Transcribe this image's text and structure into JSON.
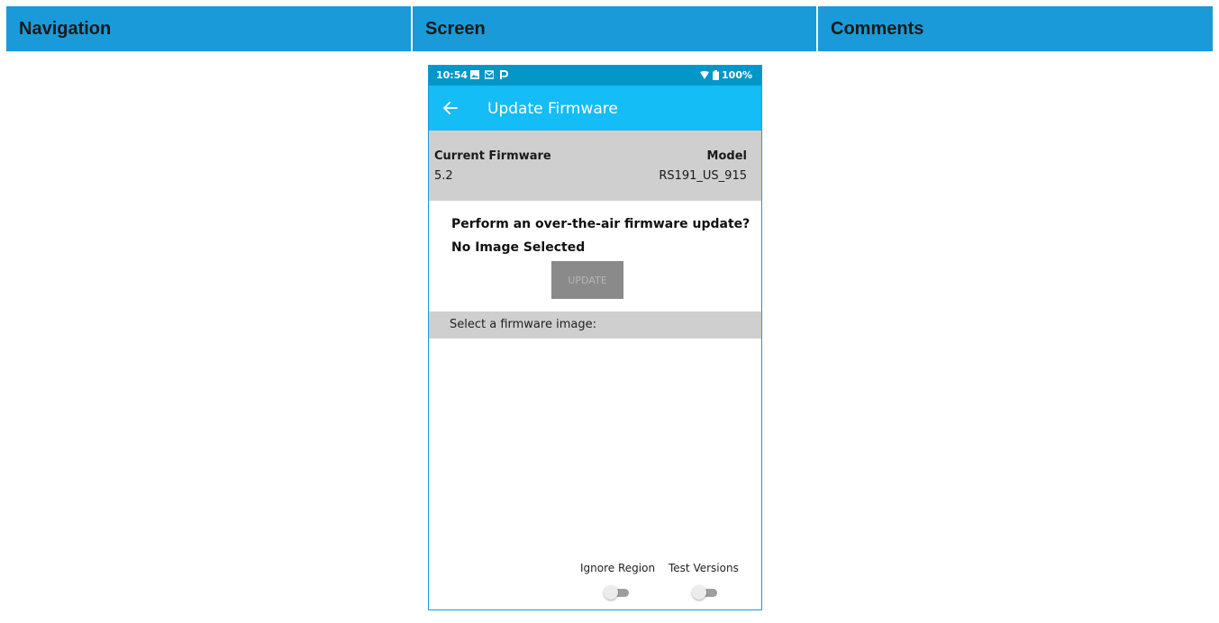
{
  "table": {
    "columns": [
      "Navigation",
      "Screen",
      "Comments"
    ]
  },
  "phone": {
    "status_bar": {
      "time": "10:54",
      "battery": "100%",
      "icons": [
        "image-icon",
        "mail-icon",
        "p-app-icon",
        "wifi-icon",
        "battery-icon"
      ]
    },
    "app_bar": {
      "title": "Update Firmware",
      "back_icon": "arrow-left-icon"
    },
    "info": {
      "current_firmware_label": "Current Firmware",
      "current_firmware_value": "5.2",
      "model_label": "Model",
      "model_value": "RS191_US_915"
    },
    "prompt": "Perform an over-the-air firmware update?",
    "selection_status": "No Image Selected",
    "update_button": "UPDATE",
    "select_header": "Select a firmware image:",
    "toggles": [
      {
        "label": "Ignore Region",
        "on": false
      },
      {
        "label": "Test Versions",
        "on": false
      }
    ],
    "colors": {
      "status_bar": "#0596c8",
      "app_bar": "#14bdf5",
      "table_header": "#1a9ad8"
    }
  }
}
